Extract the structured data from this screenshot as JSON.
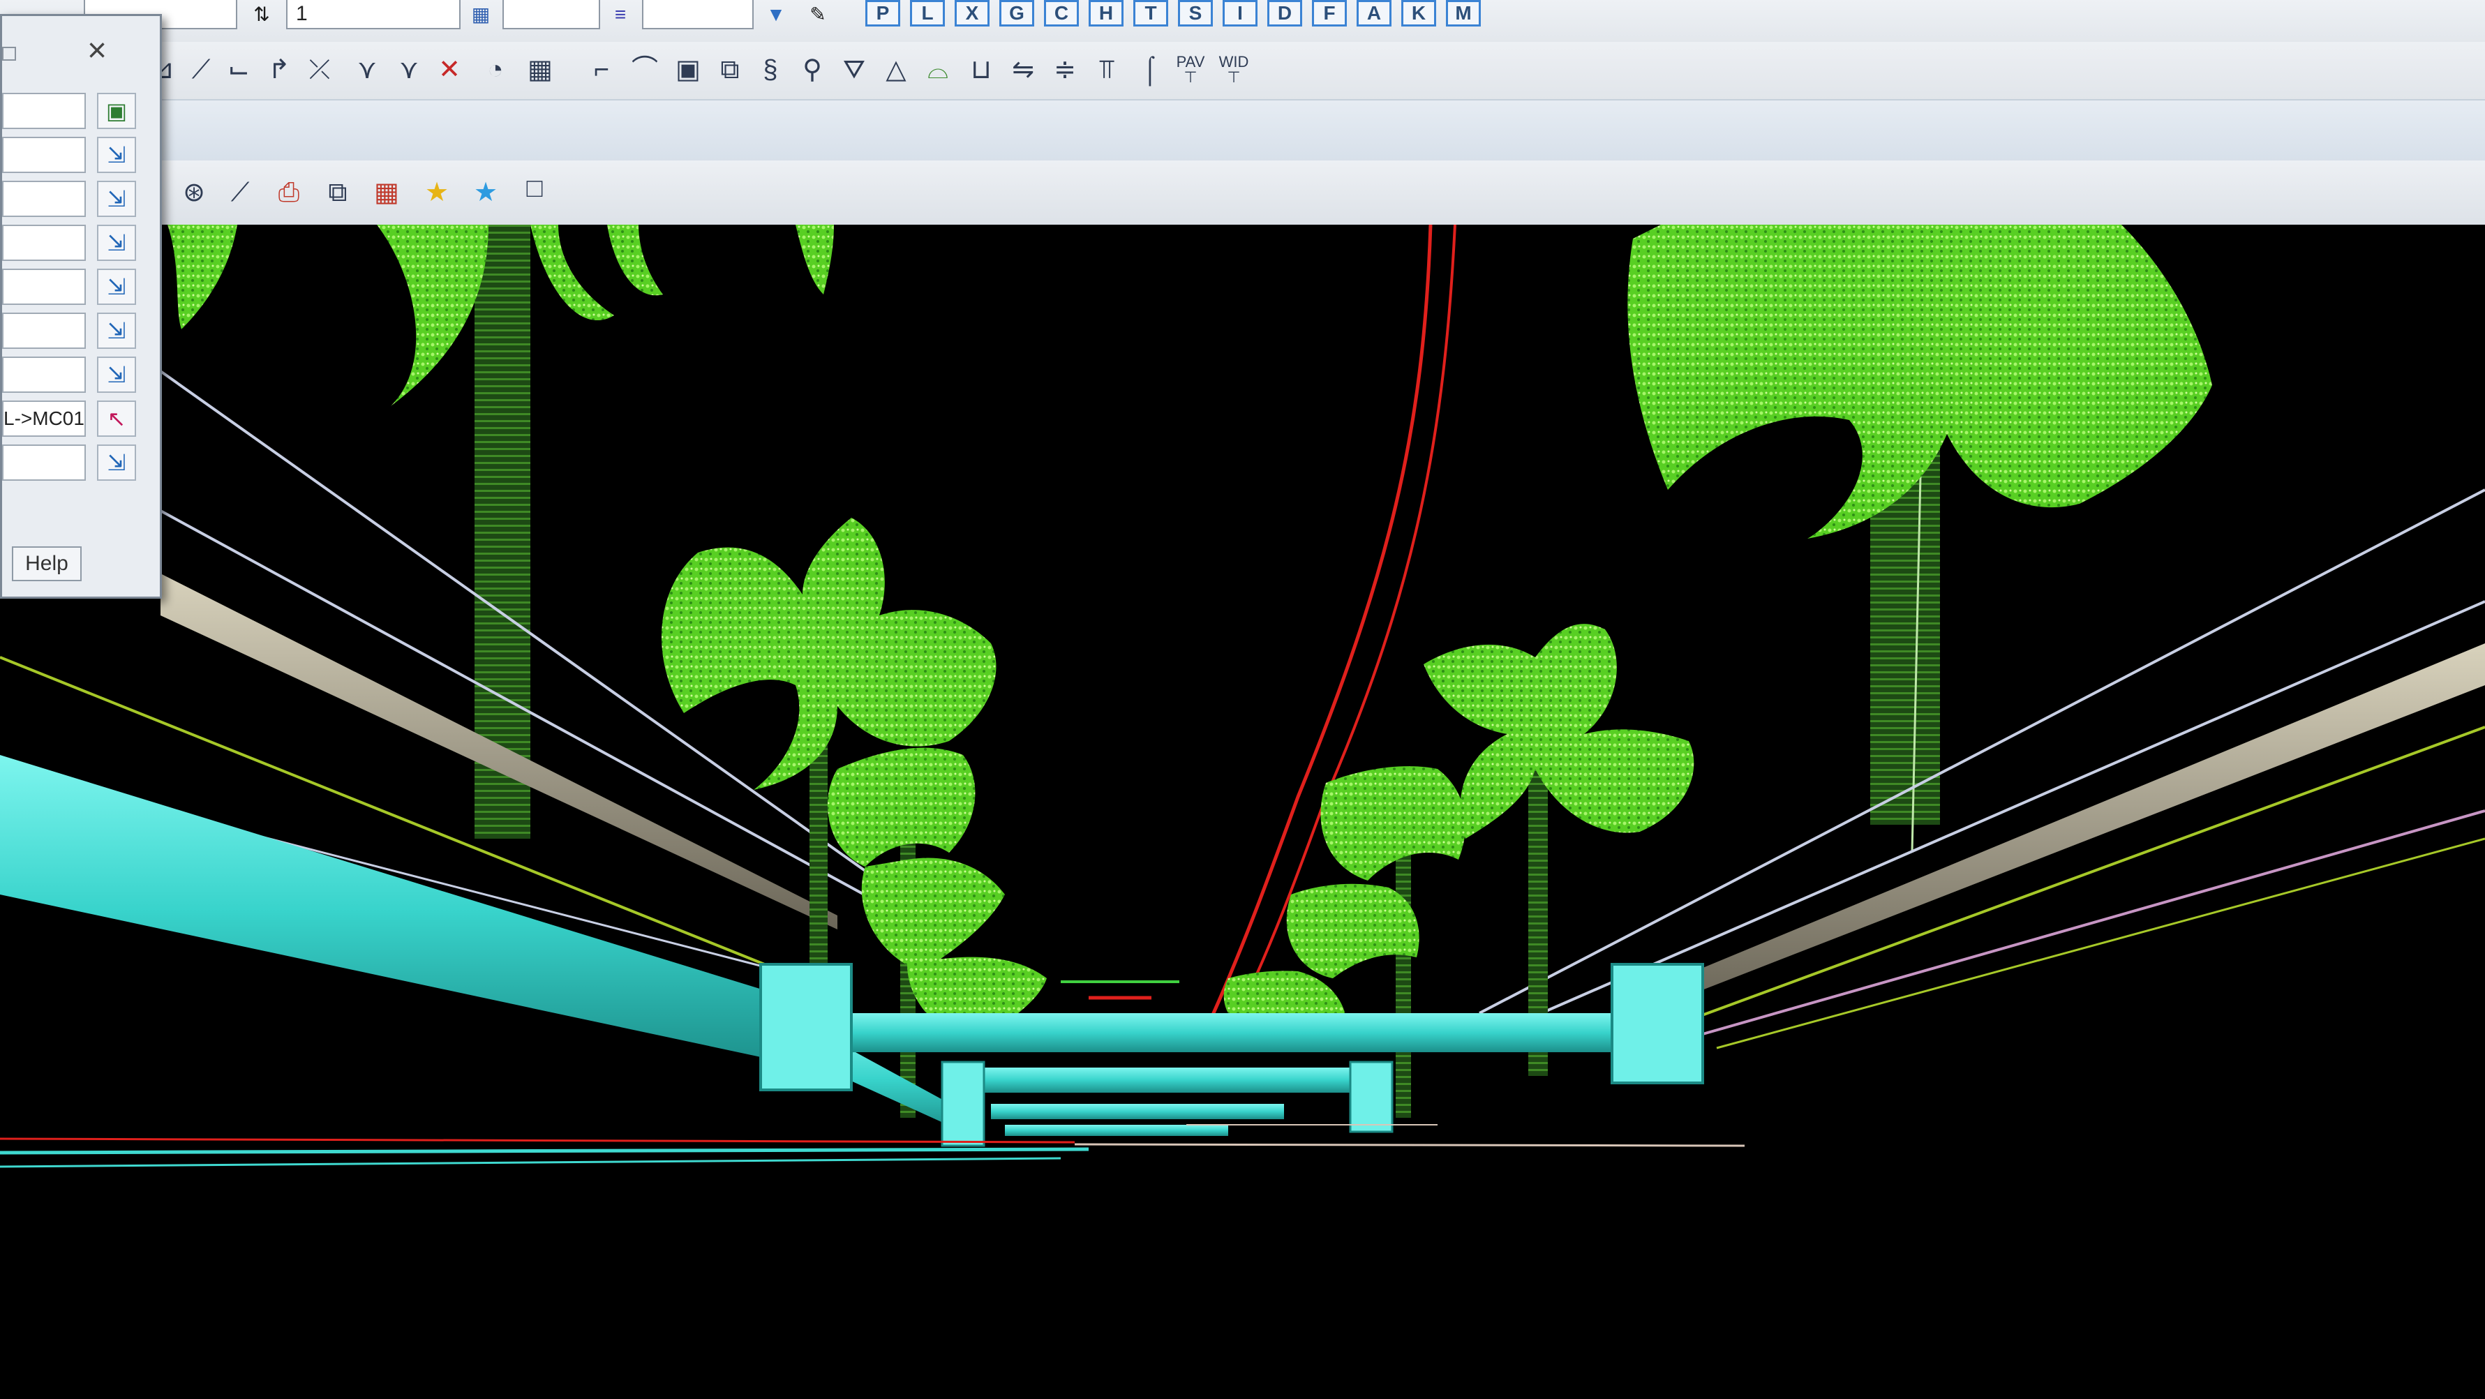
{
  "toolbar": {
    "fields": [
      {
        "id": "level-field",
        "value": ""
      },
      {
        "id": "color-field",
        "value": "1"
      },
      {
        "id": "weight-field",
        "value": ""
      },
      {
        "id": "style-field",
        "value": ""
      }
    ],
    "letter_buttons": [
      "P",
      "L",
      "X",
      "G",
      "C",
      "H",
      "T",
      "S",
      "I",
      "D",
      "F",
      "A",
      "K",
      "M"
    ],
    "pav_label": "PAV",
    "wid_label": "WID"
  },
  "palette": {
    "rows": [
      {
        "value": "",
        "icon": "monitor-icon"
      },
      {
        "value": "",
        "icon": "pick-icon"
      },
      {
        "value": "",
        "icon": "pick-icon"
      },
      {
        "value": "",
        "icon": "pick-icon"
      },
      {
        "value": "",
        "icon": "pick-icon"
      },
      {
        "value": "",
        "icon": "pick-icon"
      },
      {
        "value": "",
        "icon": "pick-icon"
      },
      {
        "value": "L->MC01",
        "icon": "arrow-icon"
      },
      {
        "value": "",
        "icon": "pick-icon"
      }
    ],
    "help_label": "Help",
    "close_glyph": "×"
  },
  "colors": {
    "background": "#000000",
    "conduit": "#3fd9d0",
    "tree_green": "#5fdb2b",
    "red_line": "#e0201c",
    "accent_blue": "#3b83d4"
  }
}
